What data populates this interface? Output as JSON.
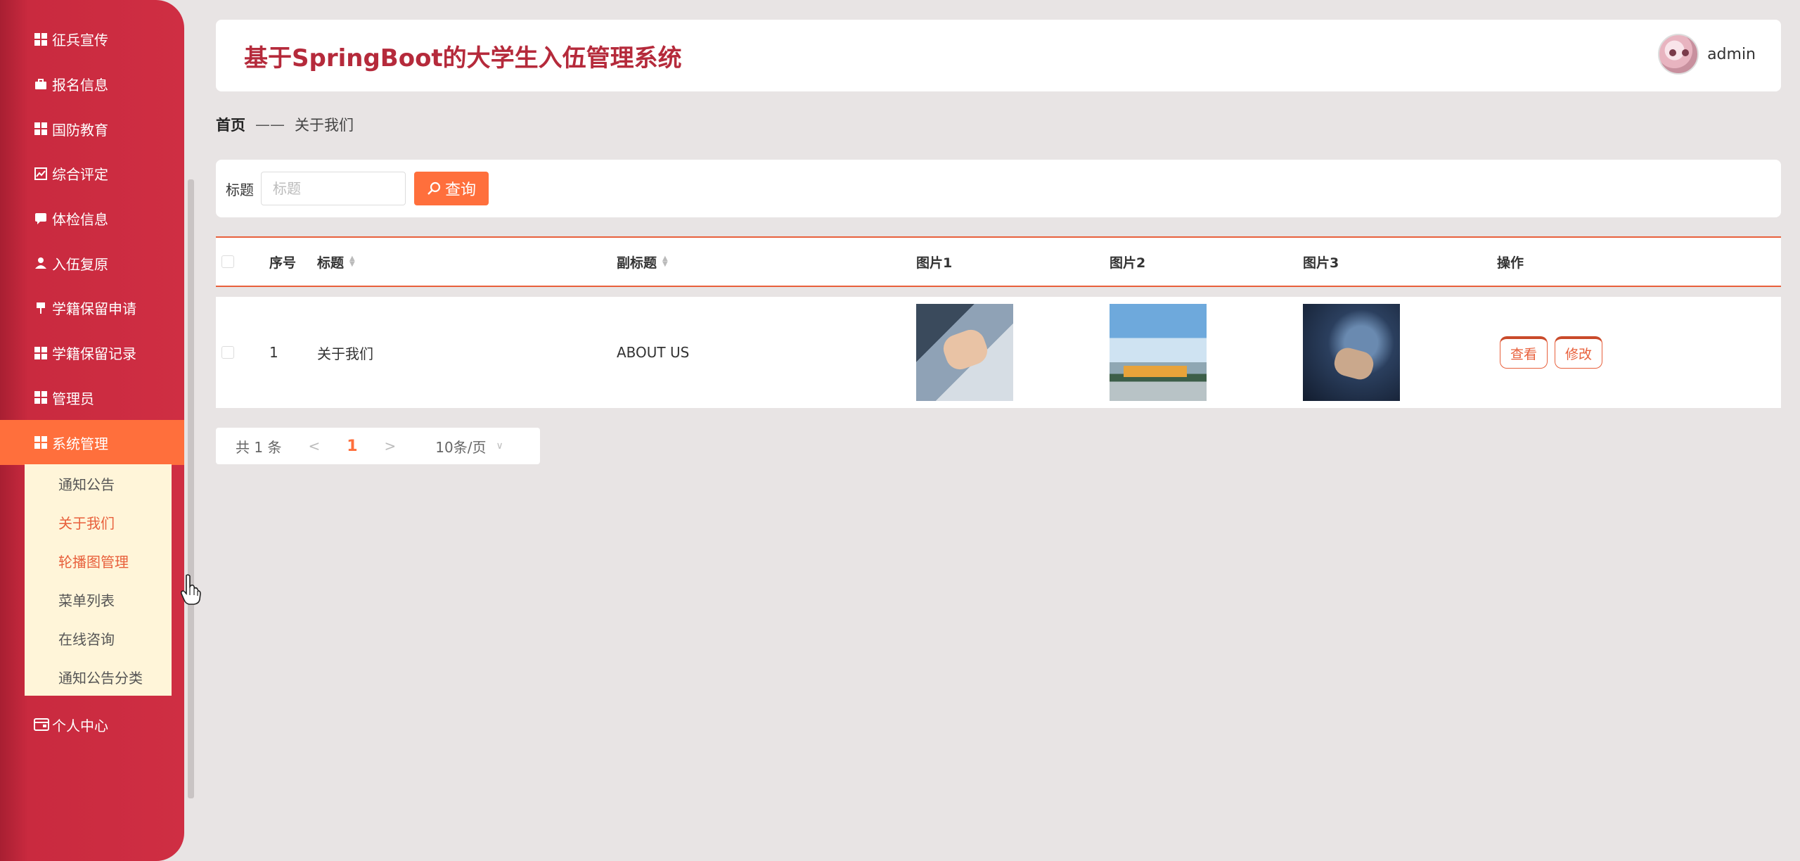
{
  "sidebar": {
    "items": [
      {
        "label": "征兵宣传",
        "icon": "grid-icon"
      },
      {
        "label": "报名信息",
        "icon": "briefcase-icon"
      },
      {
        "label": "国防教育",
        "icon": "grid-icon"
      },
      {
        "label": "综合评定",
        "icon": "chart-icon"
      },
      {
        "label": "体检信息",
        "icon": "chat-icon"
      },
      {
        "label": "入伍复原",
        "icon": "user-icon"
      },
      {
        "label": "学籍保留申请",
        "icon": "pin-icon"
      },
      {
        "label": "学籍保留记录",
        "icon": "grid-icon"
      },
      {
        "label": "管理员",
        "icon": "grid-icon"
      },
      {
        "label": "系统管理",
        "icon": "grid-icon"
      }
    ],
    "submenu": [
      {
        "label": "通知公告"
      },
      {
        "label": "关于我们"
      },
      {
        "label": "轮播图管理"
      },
      {
        "label": "菜单列表"
      },
      {
        "label": "在线咨询"
      },
      {
        "label": "通知公告分类"
      }
    ],
    "personal": {
      "label": "个人中心",
      "icon": "card-icon"
    }
  },
  "header": {
    "title": "基于SpringBoot的大学生入伍管理系统",
    "username": "admin"
  },
  "breadcrumb": {
    "home": "首页",
    "separator": "——",
    "current": "关于我们"
  },
  "search": {
    "label": "标题",
    "placeholder": "标题",
    "button_label": "查询"
  },
  "table": {
    "headers": {
      "index": "序号",
      "title": "标题",
      "subtitle": "副标题",
      "image1": "图片1",
      "image2": "图片2",
      "image3": "图片3",
      "actions": "操作"
    },
    "rows": [
      {
        "index": "1",
        "title": "关于我们",
        "subtitle": "ABOUT US",
        "view_label": "查看",
        "edit_label": "修改"
      }
    ]
  },
  "pagination": {
    "total": "共 1 条",
    "prev": "<",
    "page": "1",
    "next": ">",
    "page_size": "10条/页"
  },
  "colors": {
    "sidebar": "#cf2e43",
    "accent": "#ff6f3c",
    "title": "#b52a3b",
    "submenu_bg": "#fff5d9"
  }
}
